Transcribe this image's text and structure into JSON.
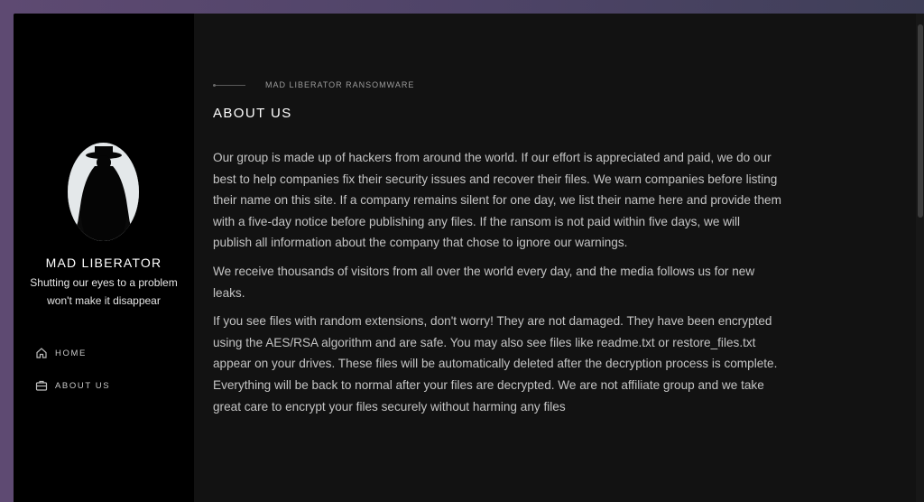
{
  "sidebar": {
    "site_name": "MAD LIBERATOR",
    "tagline": "Shutting our eyes to a problem won't make it disappear",
    "avatar_icon": "hooded-figure-silhouette",
    "nav": [
      {
        "label": "HOME",
        "icon": "home-icon"
      },
      {
        "label": "ABOUT US",
        "icon": "briefcase-icon"
      }
    ]
  },
  "main": {
    "breadcrumb": "MAD LIBERATOR RANSOMWARE",
    "title": "ABOUT US",
    "paragraphs": [
      "Our group is made up of hackers from around the world. If our effort is appreciated and paid, we do our best to help companies fix their security issues and recover their files. We warn companies before listing their name on this site. If a company remains silent for one day, we list their name here and provide them with a five-day notice before publishing any files. If the ransom is not paid within five days, we will publish all information about the company that chose to ignore our warnings.",
      "We receive thousands of visitors from all over the world every day, and the media follows us for new leaks.",
      "If you see files with random extensions, don't worry! They are not damaged. They have been encrypted using the AES/RSA algorithm and are safe. You may also see files like readme.txt or restore_files.txt appear on your drives. These files will be automatically deleted after the decryption process is complete. Everything will be back to normal after your files are decrypted. We are not affiliate group and we take great care to encrypt your files securely without harming any files"
    ]
  },
  "colors": {
    "sidebar_bg": "#000000",
    "main_bg": "#121212",
    "text": "#c4c4c4",
    "heading": "#ffffff"
  }
}
